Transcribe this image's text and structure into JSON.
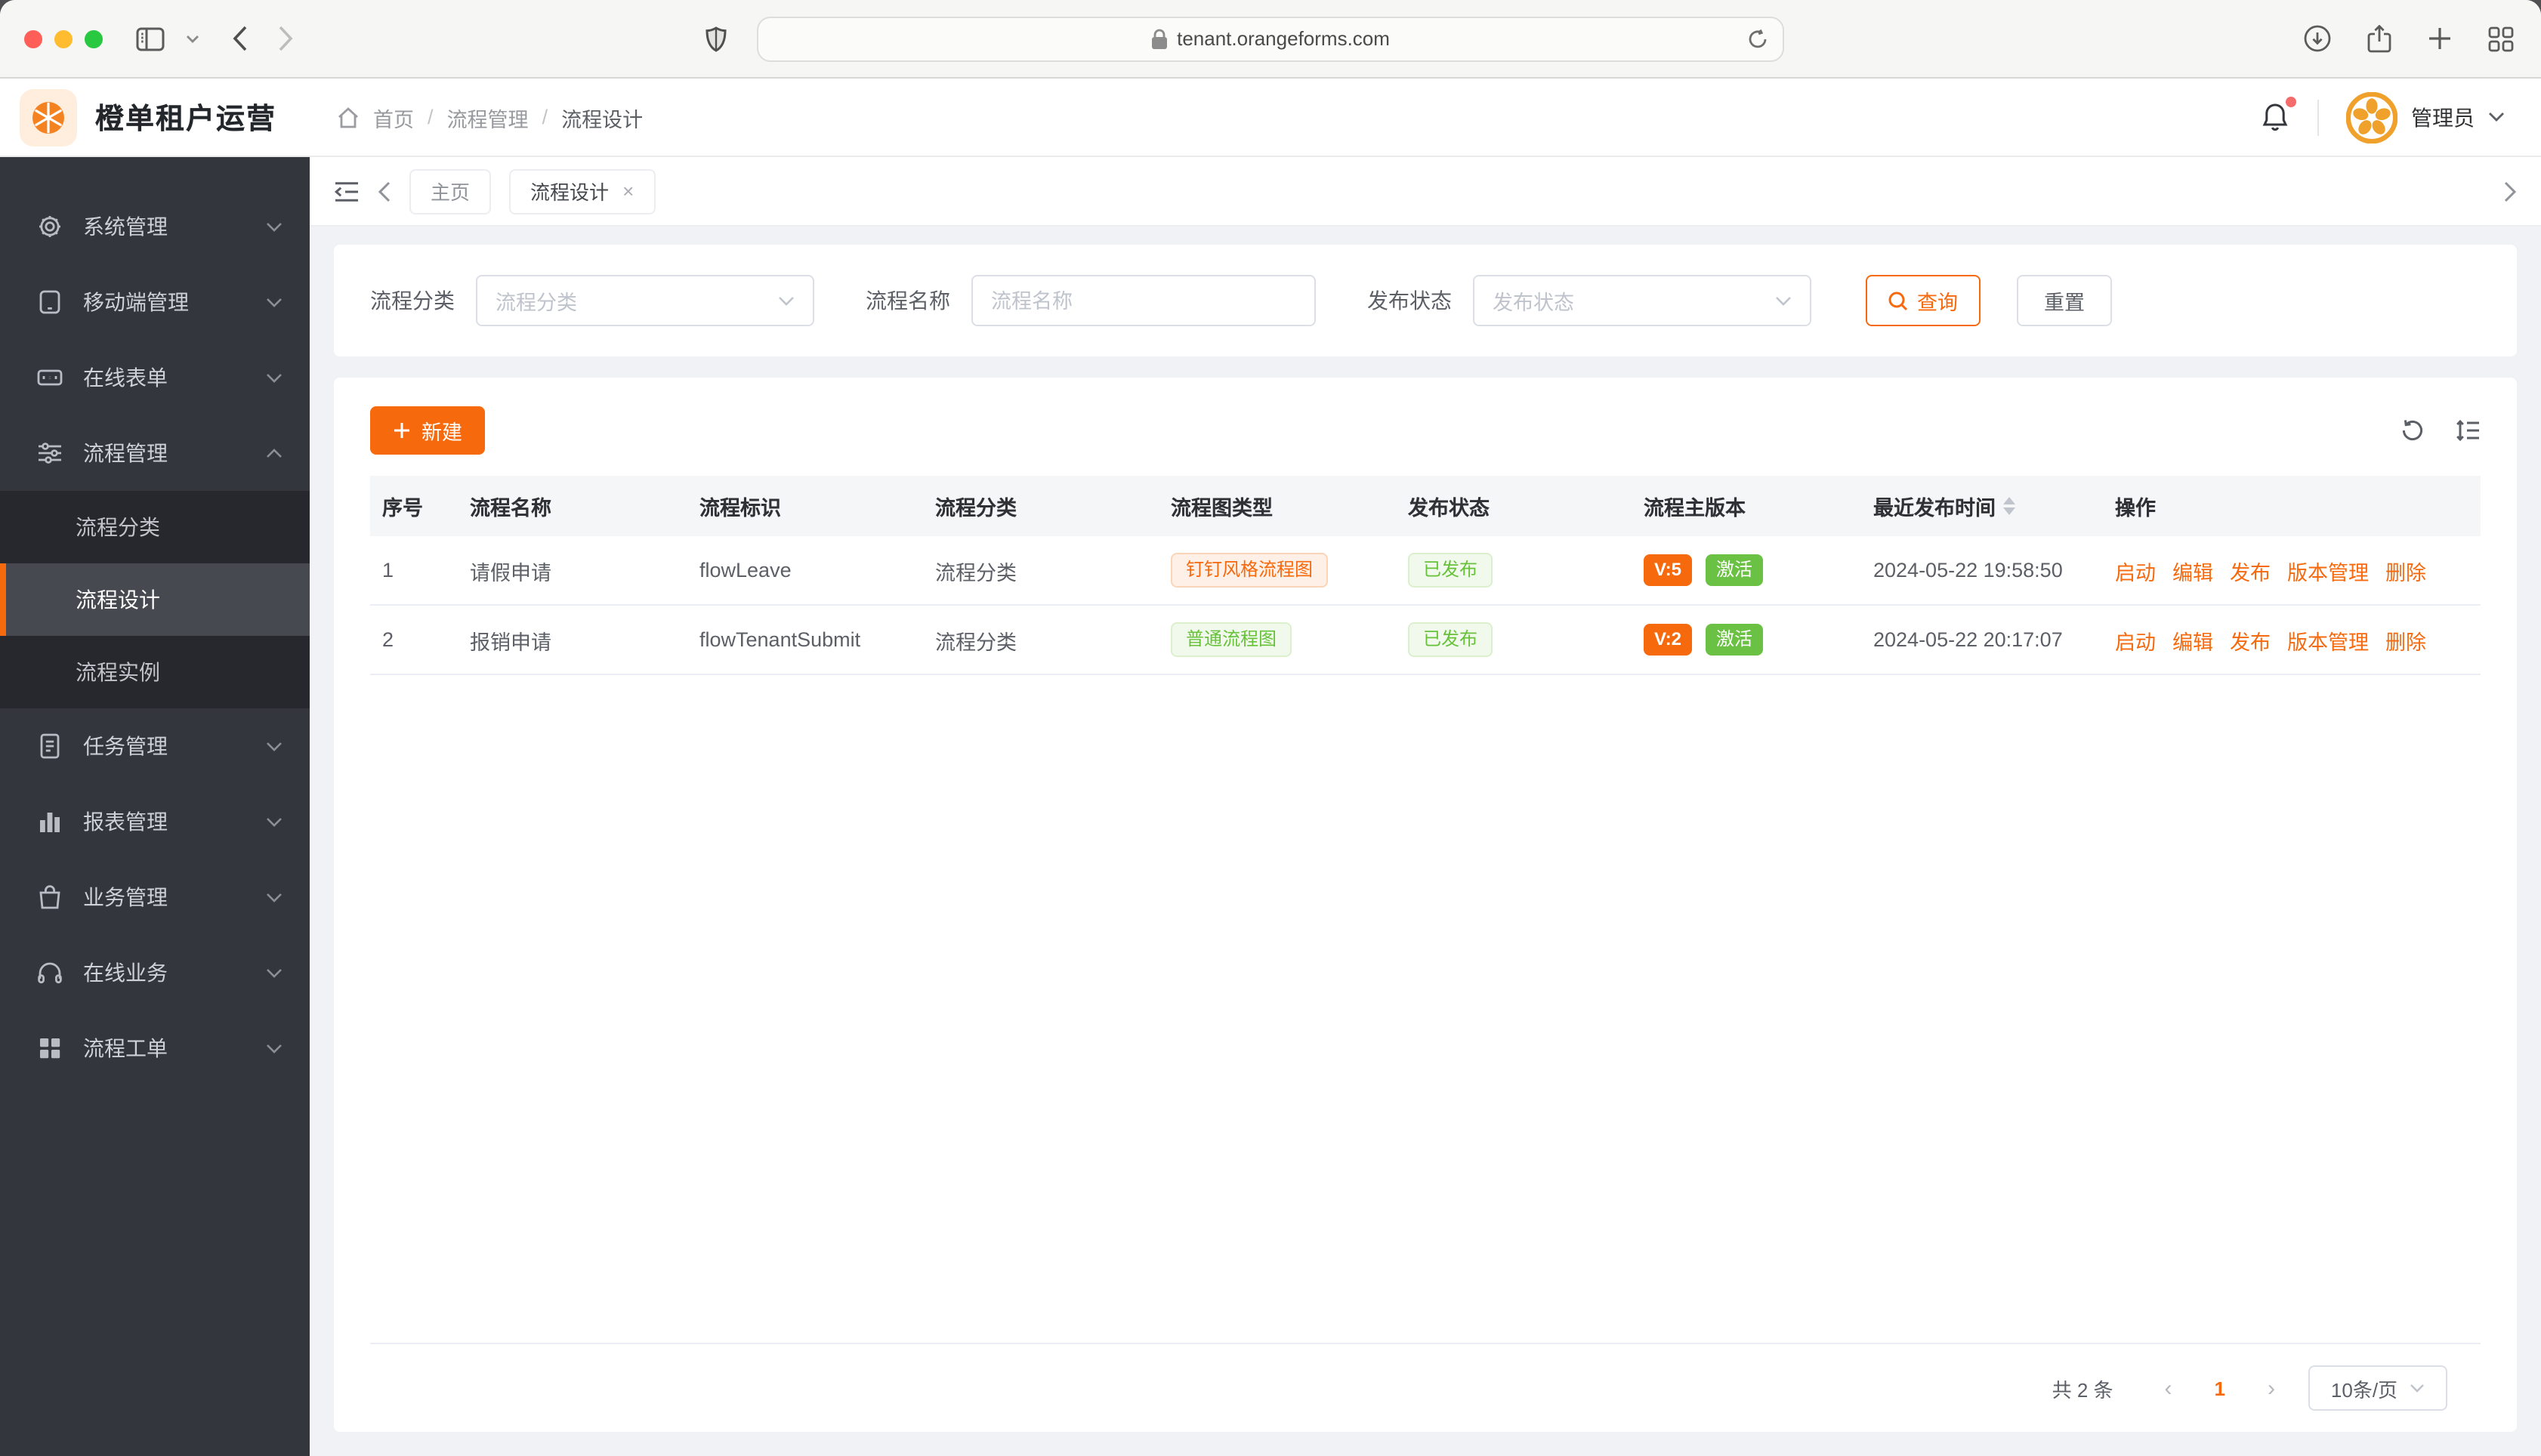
{
  "browser": {
    "url": "tenant.orangeforms.com"
  },
  "header": {
    "app_title": "橙单租户运营",
    "breadcrumbs": [
      "首页",
      "流程管理",
      "流程设计"
    ],
    "breadcrumb_separator": "/",
    "user_name": "管理员"
  },
  "sidebar": {
    "items": [
      {
        "label": "系统管理"
      },
      {
        "label": "移动端管理"
      },
      {
        "label": "在线表单"
      },
      {
        "label": "流程管理"
      },
      {
        "label": "任务管理"
      },
      {
        "label": "报表管理"
      },
      {
        "label": "业务管理"
      },
      {
        "label": "在线业务"
      },
      {
        "label": "流程工单"
      }
    ],
    "submenu": [
      {
        "label": "流程分类"
      },
      {
        "label": "流程设计"
      },
      {
        "label": "流程实例"
      }
    ]
  },
  "tabs": {
    "home": "主页",
    "active": "流程设计",
    "close_glyph": "×"
  },
  "filters": {
    "category_label": "流程分类",
    "category_placeholder": "流程分类",
    "name_label": "流程名称",
    "name_placeholder": "流程名称",
    "status_label": "发布状态",
    "status_placeholder": "发布状态",
    "search_label": "查询",
    "reset_label": "重置"
  },
  "toolbar": {
    "new_label": "新建"
  },
  "table": {
    "headers": [
      "序号",
      "流程名称",
      "流程标识",
      "流程分类",
      "流程图类型",
      "发布状态",
      "流程主版本",
      "最近发布时间",
      "操作"
    ],
    "rows": [
      {
        "no": "1",
        "name": "请假申请",
        "key": "flowLeave",
        "category": "流程分类",
        "diagram": "钉钉风格流程图",
        "status": "已发布",
        "version": "V:5",
        "state": "激活",
        "published": "2024-05-22 19:58:50",
        "actions": [
          "启动",
          "编辑",
          "发布",
          "版本管理",
          "删除"
        ]
      },
      {
        "no": "2",
        "name": "报销申请",
        "key": "flowTenantSubmit",
        "category": "流程分类",
        "diagram": "普通流程图",
        "status": "已发布",
        "version": "V:2",
        "state": "激活",
        "published": "2024-05-22 20:17:07",
        "actions": [
          "启动",
          "编辑",
          "发布",
          "版本管理",
          "删除"
        ]
      }
    ]
  },
  "pagination": {
    "total": "共 2 条",
    "page": "1",
    "page_size": "10条/页"
  },
  "colors": {
    "accent": "#f7690d",
    "brand_orange": "#f0a22e",
    "success": "#67c23a",
    "success_solid": "#6ac144"
  }
}
